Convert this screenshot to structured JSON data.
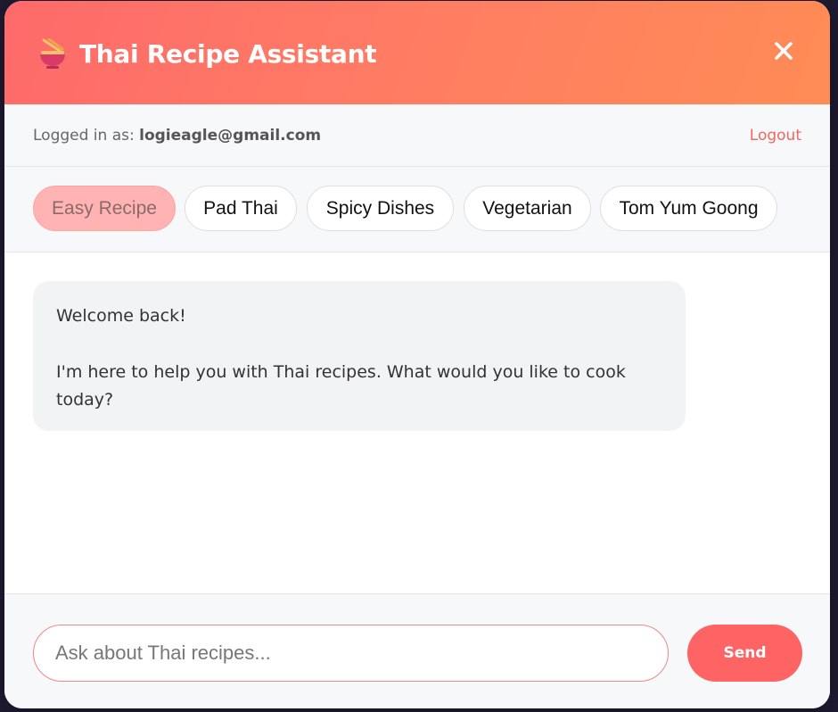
{
  "header": {
    "title": "Thai Recipe Assistant",
    "icon": "noodle-bowl-icon",
    "close_icon": "close-icon",
    "gradient_start": "#fe6a6a",
    "gradient_end": "#ff8c55"
  },
  "userbar": {
    "logged_in_label": "Logged in as:",
    "email": "logieagle@gmail.com",
    "logout_label": "Logout"
  },
  "chips": {
    "items": [
      {
        "label": "Easy Recipe",
        "active": true
      },
      {
        "label": "Pad Thai",
        "active": false
      },
      {
        "label": "Spicy Dishes",
        "active": false
      },
      {
        "label": "Vegetarian",
        "active": false
      },
      {
        "label": "Tom Yum Goong",
        "active": false
      }
    ]
  },
  "messages": [
    {
      "role": "assistant",
      "lines": [
        "Welcome back!",
        "I'm here to help you with Thai recipes. What would you like to cook today?"
      ]
    }
  ],
  "composer": {
    "placeholder": "Ask about Thai recipes...",
    "value": "",
    "send_label": "Send"
  },
  "colors": {
    "accent": "#fe6464",
    "link": "#f0675f",
    "active_chip": "#ffb3b3"
  }
}
